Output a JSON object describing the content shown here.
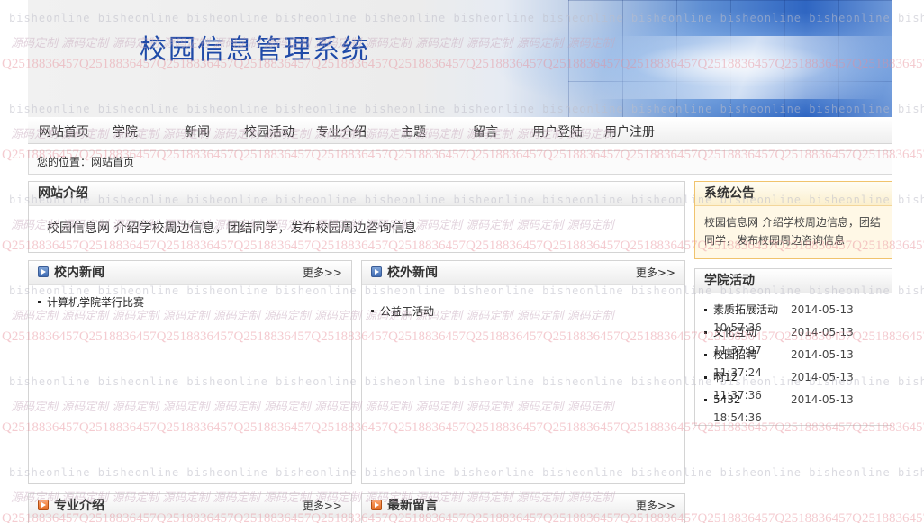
{
  "header": {
    "title": "校园信息管理系统"
  },
  "nav": {
    "items": [
      "网站首页",
      "学院",
      "新闻",
      "校园活动",
      "专业介绍",
      "主题",
      "留言",
      "用户登陆",
      "用户注册"
    ]
  },
  "breadcrumb": {
    "text": "您的位置：网站首页"
  },
  "intro": {
    "title": "网站介绍",
    "body": "校园信息网 介绍学校周边信息，团结同学，发布校园周边咨询信息"
  },
  "notice": {
    "title": "系统公告",
    "body": "校园信息网 介绍学校周边信息，团结同学，发布校园周边咨询信息"
  },
  "campus_news": {
    "title": "校内新闻",
    "more": "更多>>",
    "items": [
      "计算机学院举行比赛"
    ]
  },
  "outside_news": {
    "title": "校外新闻",
    "more": "更多>>",
    "items": [
      "公益工活动"
    ]
  },
  "activities": {
    "title": "学院活动",
    "items": [
      {
        "title": "素质拓展活动",
        "date": "2014-05-13 10:57:36"
      },
      {
        "title": "文化互动",
        "date": "2014-05-13 11:37:07"
      },
      {
        "title": "校园招聘",
        "date": "2014-05-13 11:37:24"
      },
      {
        "title": "啊12",
        "date": "2014-05-13 11:37:36"
      },
      {
        "title": "5432",
        "date": "2014-05-13 18:54:36"
      }
    ]
  },
  "major": {
    "title": "专业介绍",
    "more": "更多>>"
  },
  "messages": {
    "title": "最新留言",
    "more": "更多>>"
  },
  "watermark": {
    "site": "bisheonline",
    "custom": "源码定制",
    "qq": "Q2518836457"
  },
  "colors": {
    "title_blue": "#1f4aa8",
    "notice_border": "#f0c36d",
    "notice_bg": "#fff8e6"
  }
}
